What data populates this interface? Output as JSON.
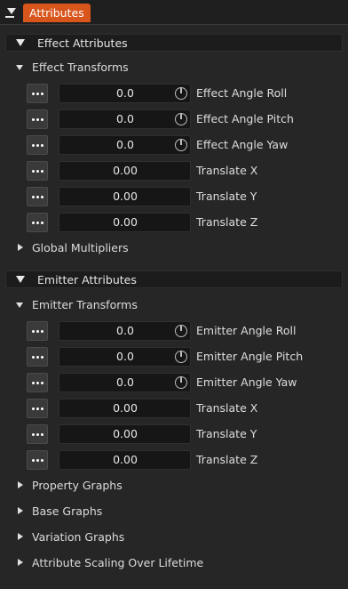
{
  "tab": {
    "label": "Attributes"
  },
  "sections": {
    "effect": {
      "header": "Effect Attributes",
      "transforms": {
        "label": "Effect Transforms",
        "rows": [
          {
            "value": "0.0",
            "label": "Effect Angle Roll"
          },
          {
            "value": "0.0",
            "label": "Effect Angle Pitch"
          },
          {
            "value": "0.0",
            "label": "Effect Angle Yaw"
          },
          {
            "value": "0.00",
            "label": "Translate X"
          },
          {
            "value": "0.00",
            "label": "Translate Y"
          },
          {
            "value": "0.00",
            "label": "Translate Z"
          }
        ]
      },
      "global_multipliers": "Global Multipliers"
    },
    "emitter": {
      "header": "Emitter Attributes",
      "transforms": {
        "label": "Emitter Transforms",
        "rows": [
          {
            "value": "0.0",
            "label": "Emitter Angle Roll"
          },
          {
            "value": "0.0",
            "label": "Emitter Angle Pitch"
          },
          {
            "value": "0.0",
            "label": "Emitter Angle Yaw"
          },
          {
            "value": "0.00",
            "label": "Translate X"
          },
          {
            "value": "0.00",
            "label": "Translate Y"
          },
          {
            "value": "0.00",
            "label": "Translate Z"
          }
        ]
      },
      "groups": [
        "Property Graphs",
        "Base Graphs",
        "Variation Graphs",
        "Attribute Scaling Over Lifetime"
      ]
    }
  }
}
